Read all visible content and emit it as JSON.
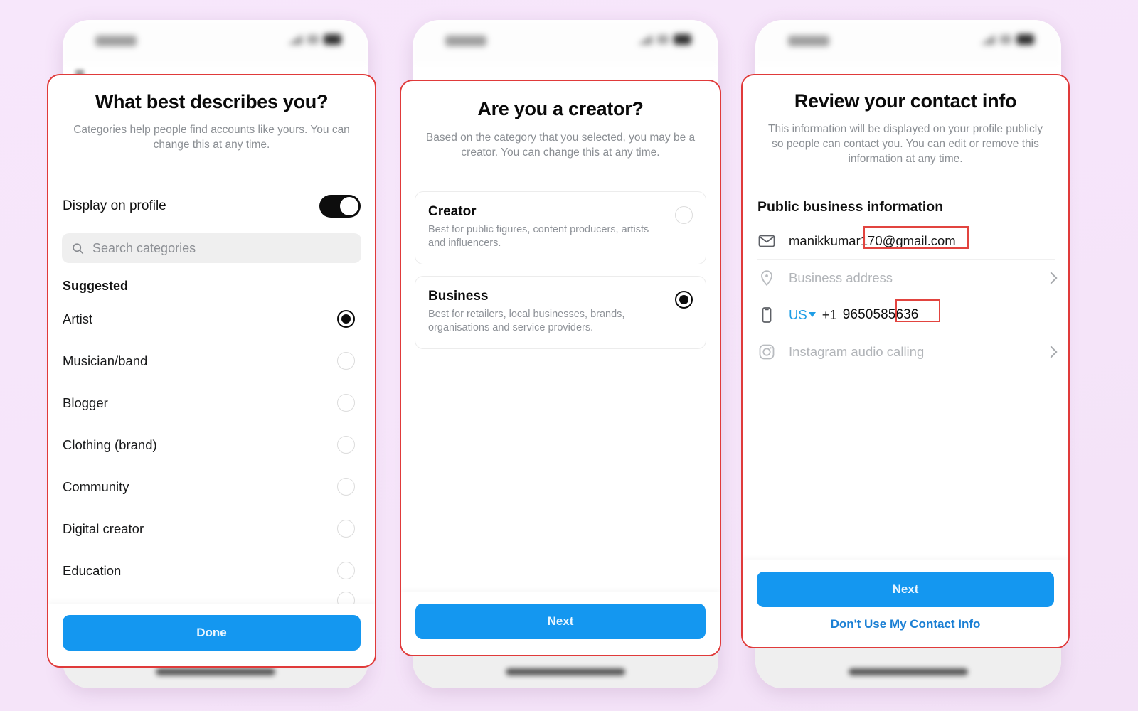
{
  "background_color": "#f6e5fa",
  "accent_color": "#1497f0",
  "annotation_color": "#e2443f",
  "screens": [
    {
      "id": "categories",
      "title": "What best describes you?",
      "subtitle": "Categories help people find accounts like yours. You can change this at any time.",
      "display_toggle": {
        "label": "Display on profile",
        "state": "on"
      },
      "search": {
        "placeholder": "Search categories",
        "value": ""
      },
      "section_header": "Suggested",
      "categories": [
        {
          "label": "Artist",
          "selected": true
        },
        {
          "label": "Musician/band",
          "selected": false
        },
        {
          "label": "Blogger",
          "selected": false
        },
        {
          "label": "Clothing (brand)",
          "selected": false
        },
        {
          "label": "Community",
          "selected": false
        },
        {
          "label": "Digital creator",
          "selected": false
        },
        {
          "label": "Education",
          "selected": false
        }
      ],
      "primary_button": "Done"
    },
    {
      "id": "creator",
      "title": "Are you a creator?",
      "subtitle": "Based on the category that you selected, you may be a creator. You can change this at any time.",
      "options": [
        {
          "title": "Creator",
          "description": "Best for public figures, content producers, artists and influencers.",
          "selected": false
        },
        {
          "title": "Business",
          "description": "Best for retailers, local businesses, brands, organisations and service providers.",
          "selected": true
        }
      ],
      "primary_button": "Next"
    },
    {
      "id": "contact",
      "title": "Review your contact info",
      "subtitle": "This information will be displayed on your profile publicly so people can contact you. You can edit or remove this information at any time.",
      "section_header": "Public business information",
      "rows": [
        {
          "icon": "envelope-icon",
          "value": "manikkumar170@gmail.com",
          "muted": false,
          "chevron": false
        },
        {
          "icon": "location-pin-icon",
          "value": "Business address",
          "muted": true,
          "chevron": true
        },
        {
          "icon": "mobile-phone-icon",
          "country_code": "US",
          "dial_code": "+1",
          "value": "9650585636",
          "muted": false,
          "chevron": false
        },
        {
          "icon": "instagram-icon",
          "value": "Instagram audio calling",
          "muted": true,
          "chevron": true
        }
      ],
      "primary_button": "Next",
      "secondary_link": "Don't Use My Contact Info"
    }
  ]
}
